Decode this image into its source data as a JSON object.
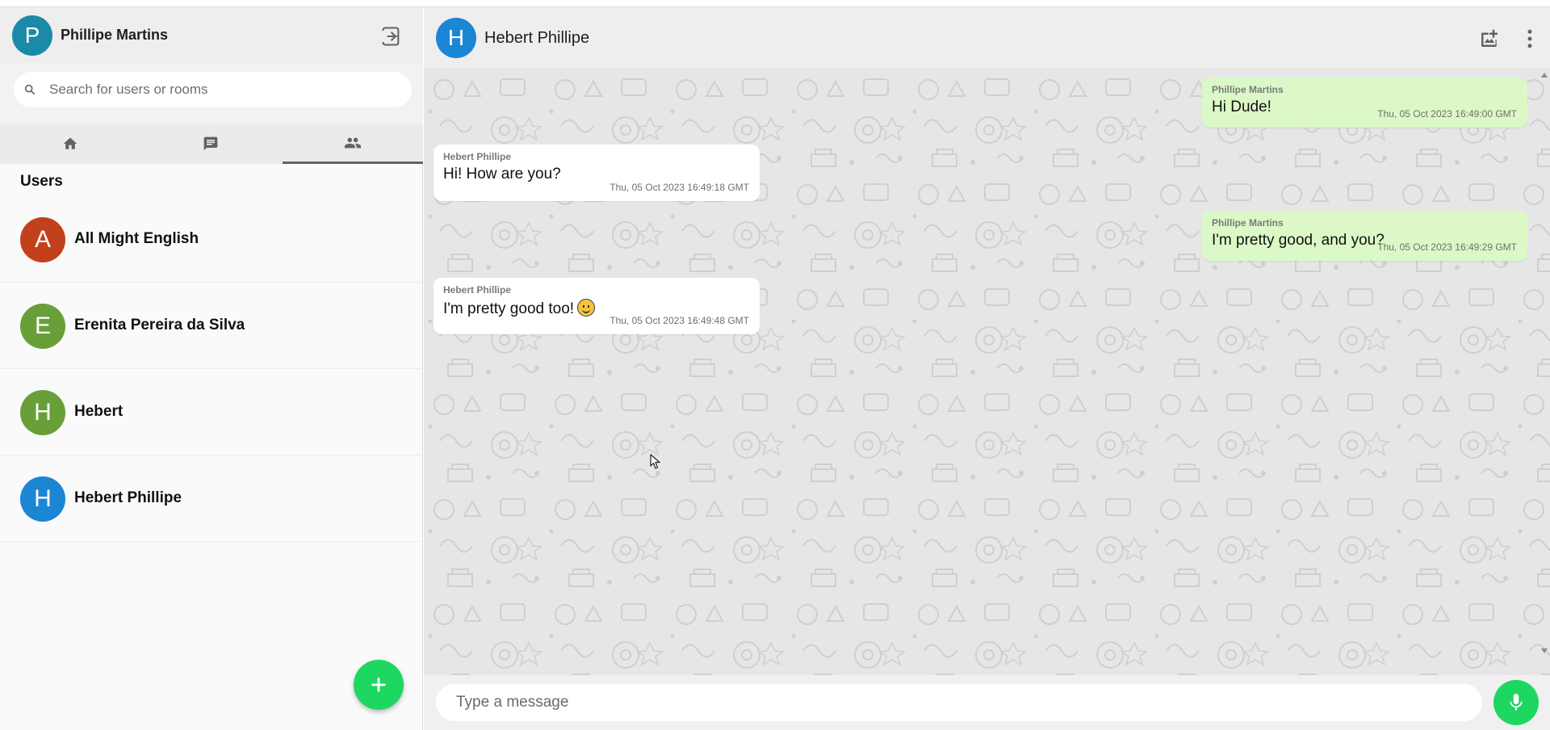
{
  "current_user": {
    "name": "Phillipe Martins",
    "initial": "P",
    "avatar_color": "#1b8aa8"
  },
  "search": {
    "placeholder": "Search for users or rooms"
  },
  "tabs": [
    {
      "icon": "home-icon"
    },
    {
      "icon": "chat-icon"
    },
    {
      "icon": "people-icon",
      "active": true
    }
  ],
  "users_section": {
    "title": "Users",
    "items": [
      {
        "name": "All Might English",
        "initial": "A",
        "color": "#c2401c"
      },
      {
        "name": "Erenita Pereira da Silva",
        "initial": "E",
        "color": "#689f38"
      },
      {
        "name": "Hebert",
        "initial": "H",
        "color": "#689f38"
      },
      {
        "name": "Hebert Phillipe",
        "initial": "H",
        "color": "#1b86d4"
      }
    ]
  },
  "chat": {
    "contact": {
      "name": "Hebert Phillipe",
      "initial": "H",
      "avatar_color": "#1b86d4"
    },
    "messages": [
      {
        "direction": "out",
        "sender": "Phillipe Martins",
        "text": "Hi Dude!",
        "time": "Thu, 05 Oct 2023 16:49:00 GMT"
      },
      {
        "direction": "in",
        "sender": "Hebert Phillipe",
        "text": "Hi! How are you?",
        "time": "Thu, 05 Oct 2023 16:49:18 GMT"
      },
      {
        "direction": "out",
        "sender": "Phillipe Martins",
        "text": "I'm pretty good, and you?",
        "time": "Thu, 05 Oct 2023 16:49:29 GMT"
      },
      {
        "direction": "in",
        "sender": "Hebert Phillipe",
        "text": "I'm pretty good too!",
        "emoji": "smiley",
        "time": "Thu, 05 Oct 2023 16:49:48 GMT"
      }
    ],
    "input_placeholder": "Type a message"
  },
  "colors": {
    "accent_green": "#1ed760",
    "outgoing_bubble": "#dcf8c6",
    "incoming_bubble": "#ffffff"
  }
}
